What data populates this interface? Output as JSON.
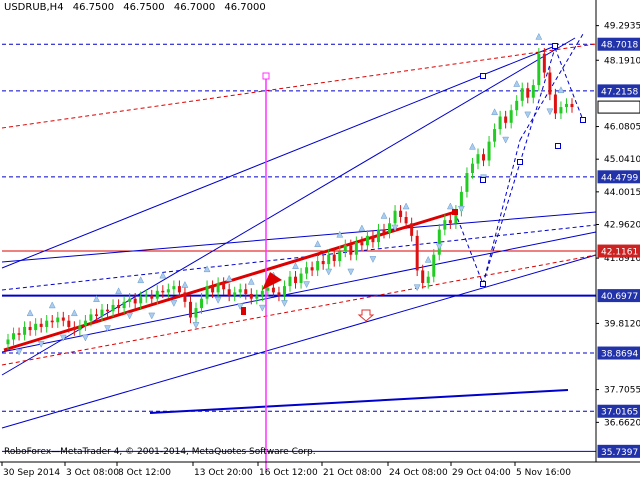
{
  "header": {
    "symbol": "USDRUB,H4",
    "open": "46.7500",
    "high": "46.7500",
    "low": "46.7000",
    "close": "46.7000"
  },
  "copyright": "RoboForex—MetaTrader 4, © 2001-2014, MetaQuotes Software Corp.",
  "colors": {
    "bull": "#22cc22",
    "bear": "#dd1111",
    "level_label_bg": "#2233aa",
    "red_label_bg": "#cc2222",
    "fractal": "#aaccee",
    "magenta": "#ff33ff",
    "blue_line": "#0000cc",
    "red_line": "#dd0000"
  },
  "chart_data": {
    "type": "candlestick",
    "symbol": "USDRUB",
    "timeframe": "H4",
    "ylim": [
      35.4,
      49.6
    ],
    "y_ticks": [
      "49.2935",
      "48.1910",
      "46.0805",
      "45.0410",
      "44.0015",
      "42.9620",
      "41.8910",
      "39.8120",
      "37.7055",
      "36.6620"
    ],
    "x_ticks": [
      "30 Sep 2014",
      "3 Oct 08:00",
      "8 Oct 12:00",
      "13 Oct 20:00",
      "16 Oct 12:00",
      "21 Oct 08:00",
      "24 Oct 08:00",
      "29 Oct 04:00",
      "5 Nov 16:00"
    ],
    "levels": [
      {
        "label": "48.7018",
        "value": 48.7018,
        "style": "dashed",
        "color": "blue"
      },
      {
        "label": "47.2158",
        "value": 47.2158,
        "style": "dashed",
        "color": "blue"
      },
      {
        "label": "46.7000",
        "value": 46.7,
        "style": "current",
        "color": "white"
      },
      {
        "label": "44.4799",
        "value": 44.4799,
        "style": "dashed",
        "color": "blue"
      },
      {
        "label": "42.1161",
        "value": 42.1161,
        "style": "solid",
        "color": "red"
      },
      {
        "label": "40.6977",
        "value": 40.6977,
        "style": "thick",
        "color": "blue"
      },
      {
        "label": "38.8694",
        "value": 38.8694,
        "style": "dashed",
        "color": "blue"
      },
      {
        "label": "37.0165",
        "value": 37.0165,
        "style": "dashed",
        "color": "blue"
      },
      {
        "label": "35.7397",
        "value": 35.7397,
        "style": "solid",
        "color": "blue"
      }
    ],
    "prices": [
      39.3,
      39.5,
      39.45,
      39.7,
      39.6,
      39.8,
      39.7,
      39.9,
      39.85,
      40.0,
      39.9,
      39.7,
      39.6,
      39.75,
      39.9,
      40.1,
      40.05,
      40.25,
      40.2,
      40.4,
      40.3,
      40.5,
      40.6,
      40.45,
      40.65,
      40.7,
      40.6,
      40.85,
      40.8,
      40.9,
      41.0,
      40.8,
      40.5,
      40.0,
      40.3,
      40.6,
      41.0,
      40.8,
      41.1,
      40.9,
      40.7,
      40.8,
      40.9,
      40.75,
      40.6,
      40.7,
      40.85,
      40.95,
      40.8,
      40.7,
      41.0,
      41.3,
      41.1,
      41.4,
      41.6,
      41.5,
      41.8,
      41.7,
      42.0,
      41.8,
      42.1,
      42.3,
      42.0,
      42.4,
      42.3,
      42.6,
      42.4,
      42.8,
      42.7,
      43.0,
      43.4,
      43.2,
      43.0,
      42.6,
      41.5,
      41.1,
      41.3,
      42.0,
      42.8,
      43.1,
      43.0,
      43.4,
      44.0,
      44.6,
      44.9,
      45.2,
      45.0,
      45.6,
      46.0,
      46.4,
      46.2,
      46.6,
      46.9,
      47.3,
      47.0,
      47.4,
      48.4,
      47.8,
      47.1,
      46.5,
      46.7,
      46.8,
      46.7
    ]
  }
}
